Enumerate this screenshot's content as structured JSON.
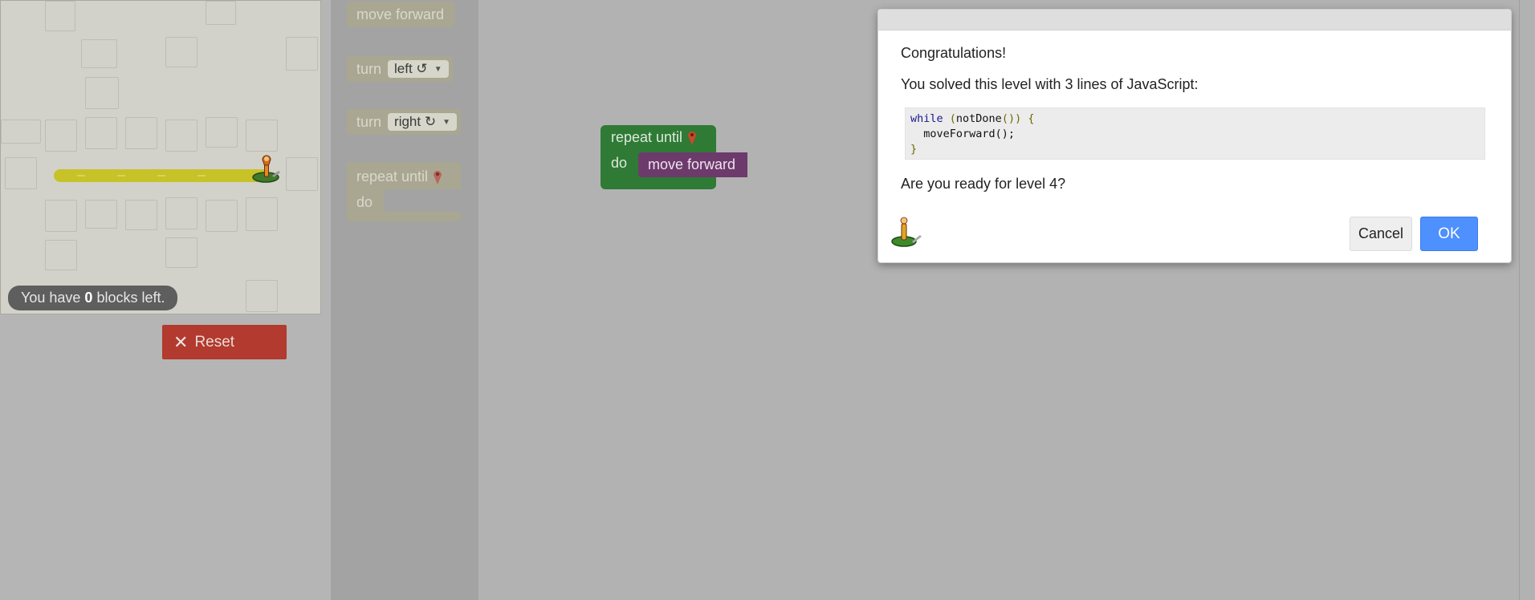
{
  "status": {
    "prefix": "You have ",
    "count": "0",
    "suffix": " blocks left."
  },
  "reset": {
    "icon": "close-icon",
    "label": "Reset"
  },
  "toolbox": {
    "move_forward": "move forward",
    "turn_left": {
      "label": "turn",
      "value": "left ↺"
    },
    "turn_right": {
      "label": "turn",
      "value": "right ↻"
    },
    "repeat_until": {
      "label": "repeat until",
      "do": "do",
      "icon": "goal-marker-icon"
    }
  },
  "workspace": {
    "repeat_label": "repeat until",
    "do_label": "do",
    "move_label": "move forward"
  },
  "dialog": {
    "congrats": "Congratulations!",
    "solved": "You solved this level with 3 lines of JavaScript:",
    "code": {
      "line1_kw": "while",
      "line1_open": " (",
      "line1_call": "notDone",
      "line1_rest": "()) {",
      "line2": "  moveForward();",
      "line3": "}"
    },
    "question": "Are you ready for level 4?",
    "cancel": "Cancel",
    "ok": "OK"
  },
  "colors": {
    "ok_button": "#4d90fe",
    "reset_button": "#b23a2e",
    "repeat_block": "#2f7a35",
    "move_block": "#6d3a6c"
  }
}
